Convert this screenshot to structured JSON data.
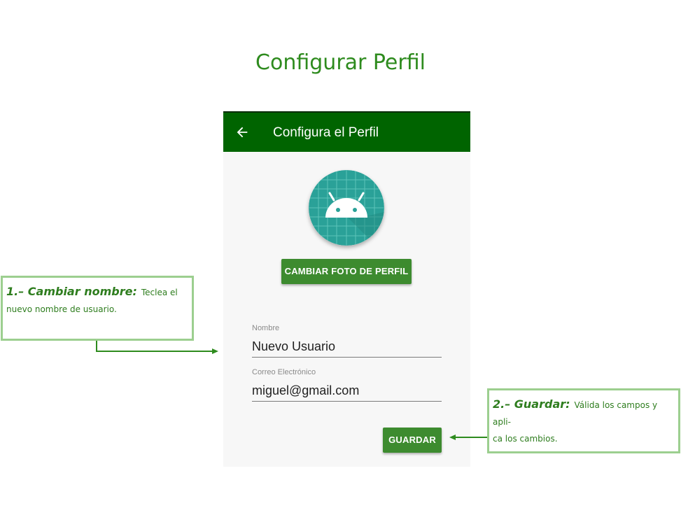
{
  "page_title": "Configurar Perfil",
  "app": {
    "toolbar_title": "Configura el Perfil",
    "back_icon": "arrow-back-icon",
    "avatar_icon": "android-icon",
    "change_photo_label": "CAMBIAR FOTO DE PERFIL",
    "fields": [
      {
        "label": "Nombre",
        "value": "Nuevo Usuario"
      },
      {
        "label": "Correo Electrónico",
        "value": "miguel@gmail.com"
      }
    ],
    "save_label": "GUARDAR"
  },
  "callouts": [
    {
      "heading": "1.– Cambiar nombre:",
      "line1": "Teclea el",
      "line2": "nuevo nombre de usuario."
    },
    {
      "heading": "2.– Guardar:",
      "line1": "Válida los campos y apli-",
      "line2": "ca los cambios."
    }
  ],
  "colors": {
    "title_green": "#2e8b1e",
    "appbar_green": "#006400",
    "button_green": "#3d8b2f",
    "avatar_teal": "#2aa198",
    "callout_border": "#9ccf8f"
  }
}
